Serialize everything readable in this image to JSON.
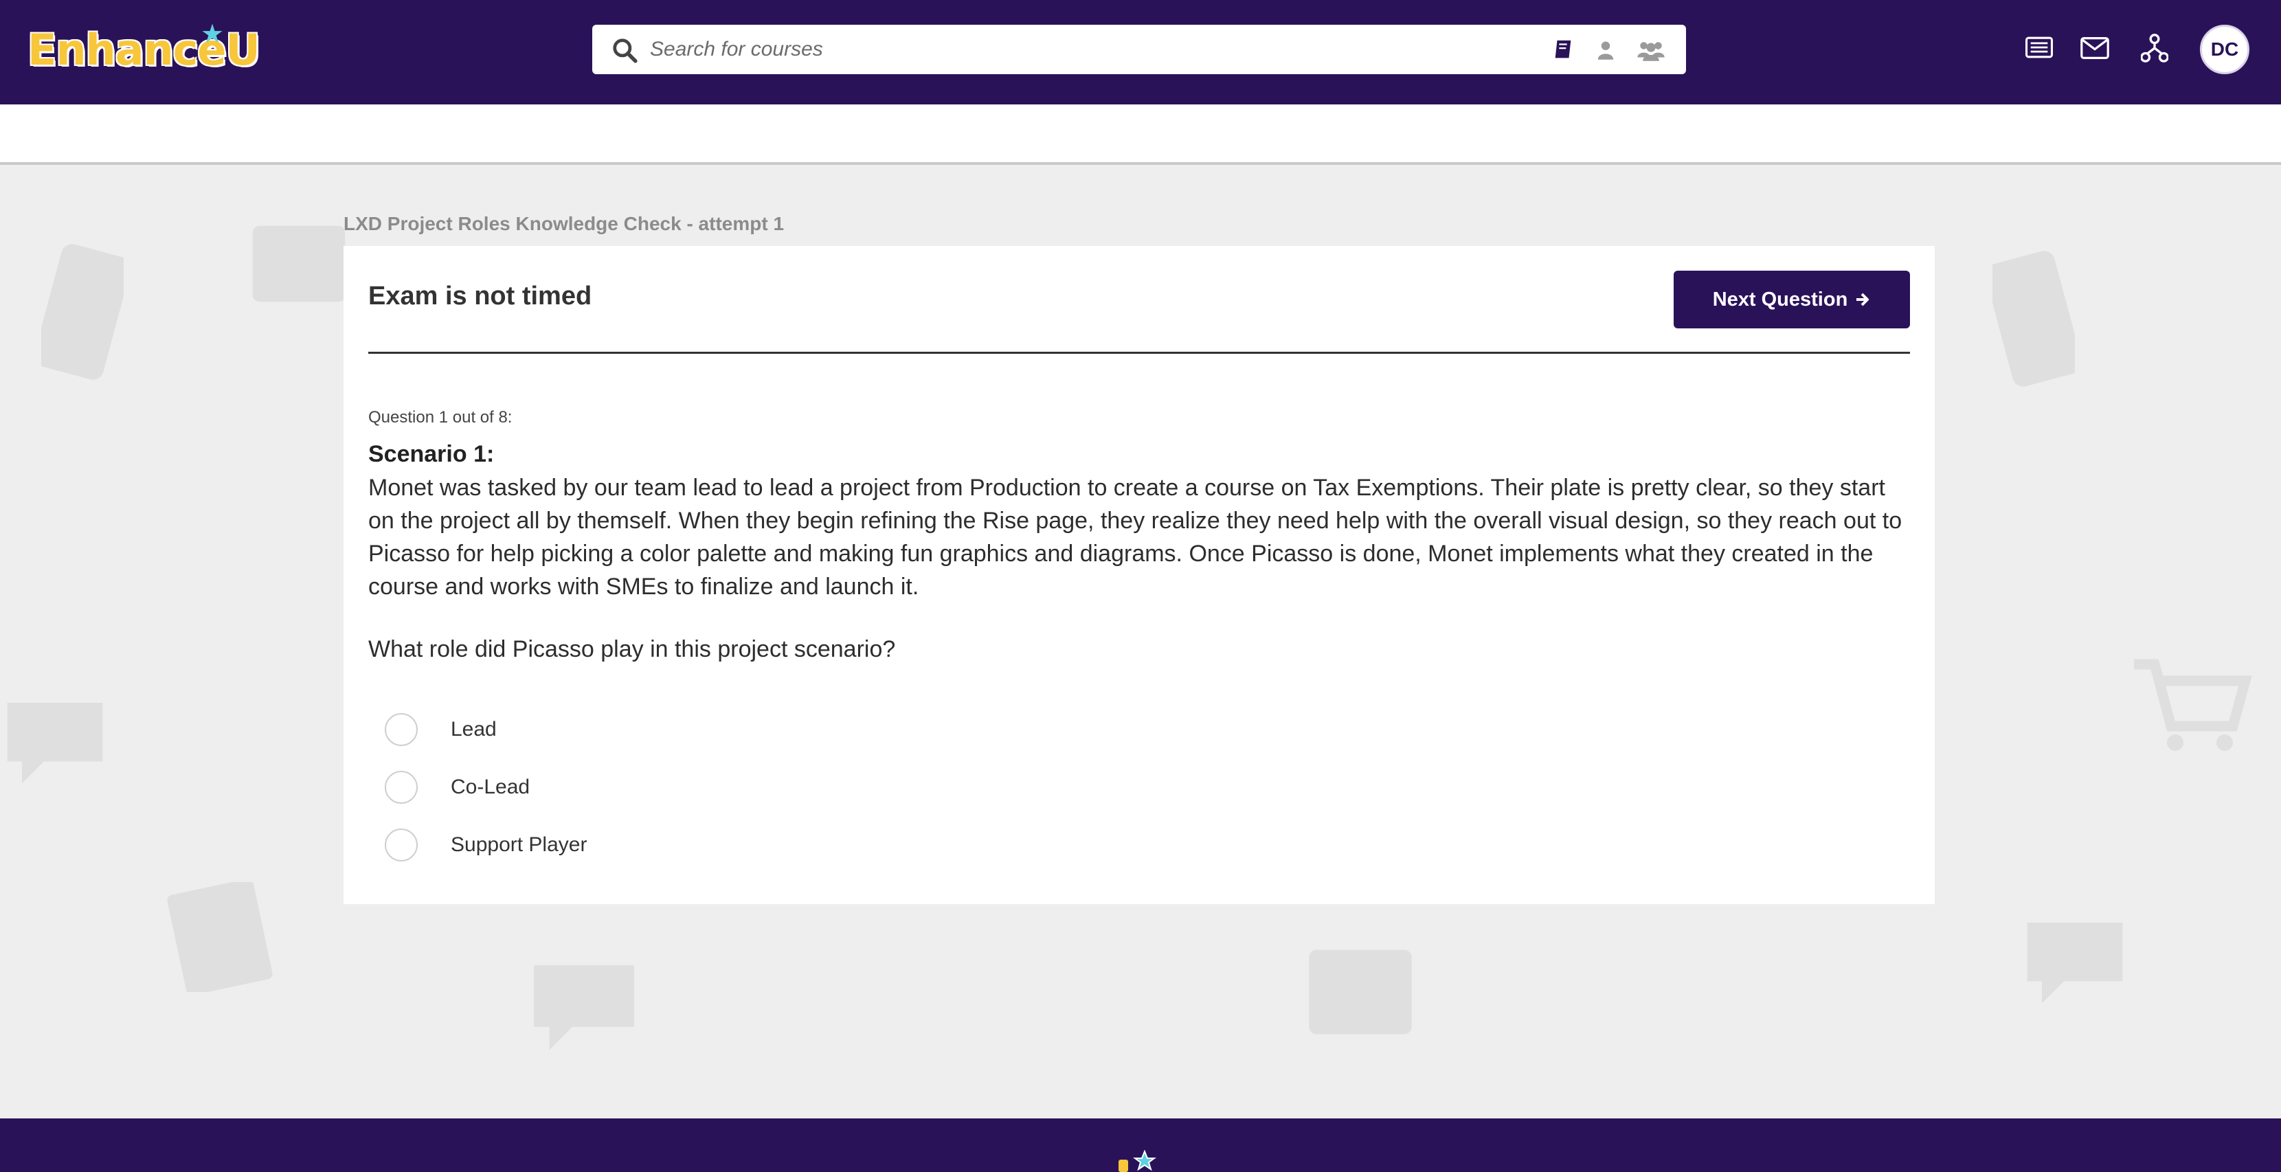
{
  "header": {
    "logo_text": "EnhanceU",
    "search_placeholder": "Search for courses",
    "filters": [
      "courses-filter-icon",
      "person-filter-icon",
      "group-filter-icon"
    ],
    "icons": [
      "list-icon",
      "mail-icon",
      "network-icon"
    ],
    "avatar_initials": "DC"
  },
  "exam": {
    "title": "LXD Project Roles Knowledge Check - attempt 1",
    "timer_text": "Exam is not timed",
    "next_label": "Next Question",
    "question_count": "Question 1 out of 8:",
    "scenario_title": "Scenario 1:",
    "scenario_text": "Monet was tasked by our team lead to lead a project from Production to create a course on Tax Exemptions. Their plate is pretty clear, so they start on the project all by themself. When they begin refining the Rise page, they realize they need help with the overall visual design, so they reach out to Picasso for help picking a color palette and making fun graphics and diagrams. Once Picasso is done, Monet implements what they created in the course and works with SMEs to finalize and launch it.",
    "question": "What role did Picasso play in this project scenario?",
    "options": [
      "Lead",
      "Co-Lead",
      "Support Player"
    ]
  },
  "colors": {
    "brand_purple": "#2a1259",
    "logo_yellow": "#f7c63b",
    "logo_accent": "#5fd1e0"
  }
}
